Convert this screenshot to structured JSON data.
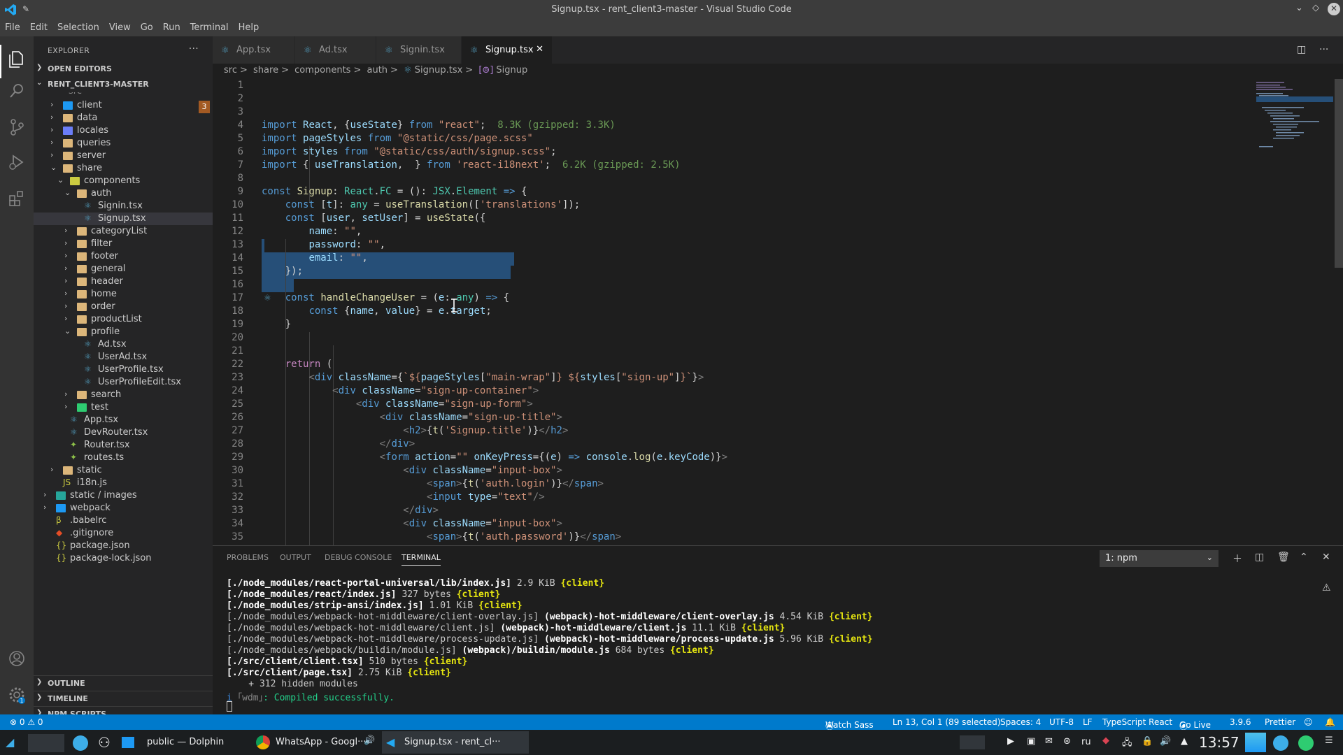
{
  "window": {
    "title": "Signup.tsx - rent_client3-master - Visual Studio Code"
  },
  "menu": [
    "File",
    "Edit",
    "Selection",
    "View",
    "Go",
    "Run",
    "Terminal",
    "Help"
  ],
  "explorer": {
    "header": "EXPLORER",
    "open_editors": "OPEN EDITORS",
    "root": "RENT_CLIENT3-MASTER",
    "partial_top": "src",
    "badge": "3",
    "items": [
      {
        "label": "client",
        "type": "folder"
      },
      {
        "label": "data",
        "type": "folder"
      },
      {
        "label": "locales",
        "type": "folder"
      },
      {
        "label": "queries",
        "type": "folder"
      },
      {
        "label": "server",
        "type": "folder"
      },
      {
        "label": "share",
        "type": "folder-open"
      },
      {
        "label": "components",
        "type": "folder-open"
      },
      {
        "label": "auth",
        "type": "folder-open"
      },
      {
        "label": "Signin.tsx",
        "type": "tsx"
      },
      {
        "label": "Signup.tsx",
        "type": "tsx"
      },
      {
        "label": "categoryList",
        "type": "folder"
      },
      {
        "label": "filter",
        "type": "folder"
      },
      {
        "label": "footer",
        "type": "folder"
      },
      {
        "label": "general",
        "type": "folder"
      },
      {
        "label": "header",
        "type": "folder"
      },
      {
        "label": "home",
        "type": "folder"
      },
      {
        "label": "order",
        "type": "folder"
      },
      {
        "label": "productList",
        "type": "folder"
      },
      {
        "label": "profile",
        "type": "folder-open"
      },
      {
        "label": "Ad.tsx",
        "type": "tsx"
      },
      {
        "label": "UserAd.tsx",
        "type": "tsx"
      },
      {
        "label": "UserProfile.tsx",
        "type": "tsx"
      },
      {
        "label": "UserProfileEdit.tsx",
        "type": "tsx"
      },
      {
        "label": "search",
        "type": "folder"
      },
      {
        "label": "test",
        "type": "folder"
      },
      {
        "label": "App.tsx",
        "type": "tsx"
      },
      {
        "label": "DevRouter.tsx",
        "type": "tsx"
      },
      {
        "label": "Router.tsx",
        "type": "ts"
      },
      {
        "label": "routes.ts",
        "type": "ts"
      },
      {
        "label": "static",
        "type": "folder"
      },
      {
        "label": "i18n.js",
        "type": "js"
      },
      {
        "label": "static / images",
        "type": "folder"
      },
      {
        "label": "webpack",
        "type": "folder"
      },
      {
        "label": ".babelrc",
        "type": "babel"
      },
      {
        "label": ".gitignore",
        "type": "git"
      },
      {
        "label": "package.json",
        "type": "json"
      },
      {
        "label": "package-lock.json",
        "type": "json"
      }
    ],
    "outline": "OUTLINE",
    "timeline": "TIMELINE",
    "npm_scripts": "NPM SCRIPTS"
  },
  "tabs": [
    {
      "label": "App.tsx"
    },
    {
      "label": "Ad.tsx"
    },
    {
      "label": "Signin.tsx"
    },
    {
      "label": "Signup.tsx",
      "active": true
    }
  ],
  "breadcrumb": [
    "src",
    ">",
    "share",
    ">",
    "components",
    ">",
    "auth",
    ">",
    "Signup.tsx",
    ">",
    "Signup"
  ],
  "editor": {
    "line_numbers": [
      "1",
      "2",
      "3",
      "4",
      "5",
      "6",
      "7",
      "8",
      "9",
      "10",
      "11",
      "12",
      "13",
      "14",
      "15",
      "16",
      "17",
      "18",
      "19",
      "20",
      "21",
      "22",
      "23",
      "24",
      "25",
      "26",
      "27",
      "28",
      "29",
      "30",
      "31",
      "32",
      "33",
      "34",
      "35"
    ]
  },
  "panel": {
    "tabs": [
      "PROBLEMS",
      "OUTPUT",
      "DEBUG CONSOLE",
      "TERMINAL"
    ],
    "terminal_select": "1: npm",
    "lines": {
      "l1a": "[./node_modules/react-portal-universal/lib/index.js]",
      "l1b": " 2.9 KiB ",
      "l1c": "{client}",
      "l2a": "[./node_modules/react/index.js]",
      "l2b": " 327 bytes ",
      "l2c": "{client}",
      "l3a": "[./node_modules/strip-ansi/index.js]",
      "l3b": " 1.01 KiB ",
      "l3c": "{client}",
      "l4a": "[./node_modules/webpack-hot-middleware/client-overlay.js]",
      "l4b": " (webpack)-hot-middleware/client-overlay.js",
      "l4c": " 4.54 KiB ",
      "l4d": "{client}",
      "l5a": "[./node_modules/webpack-hot-middleware/client.js]",
      "l5b": " (webpack)-hot-middleware/client.js",
      "l5c": " 11.1 KiB ",
      "l5d": "{client}",
      "l6a": "[./node_modules/webpack-hot-middleware/process-update.js]",
      "l6b": " (webpack)-hot-middleware/process-update.js",
      "l6c": " 5.96 KiB ",
      "l6d": "{client}",
      "l7a": "[./node_modules/webpack/buildin/module.js]",
      "l7b": " (webpack)/buildin/module.js",
      "l7c": " 684 bytes ",
      "l7d": "{client}",
      "l8a": "[./src/client/client.tsx]",
      "l8b": " 510 bytes ",
      "l8c": "{client}",
      "l9a": "[./src/client/page.tsx]",
      "l9b": " 2.75 KiB ",
      "l9c": "{client}",
      "l10": "    + 312 hidden modules",
      "l11a": "i ",
      "l11b": "｢wdm｣",
      "l11c": ": Compiled successfully."
    }
  },
  "status": {
    "problems": "⊗ 0 ⚠ 0",
    "watch": "Watch Sass",
    "position": "Ln 13, Col 1 (89 selected)",
    "spaces": "Spaces: 4",
    "encoding": "UTF-8",
    "eol": "LF",
    "language": "TypeScript React",
    "golive": "Go Live",
    "version": "3.9.6",
    "prettier": "Prettier"
  },
  "taskbar": {
    "dolphin": "public — Dolphin",
    "whatsapp": "WhatsApp - Googl···",
    "vscode": "Signup.tsx - rent_cl···",
    "lang": "ru",
    "clock": "13:57"
  },
  "colors": {
    "accent": "#007acc",
    "selection": "#264f78"
  }
}
